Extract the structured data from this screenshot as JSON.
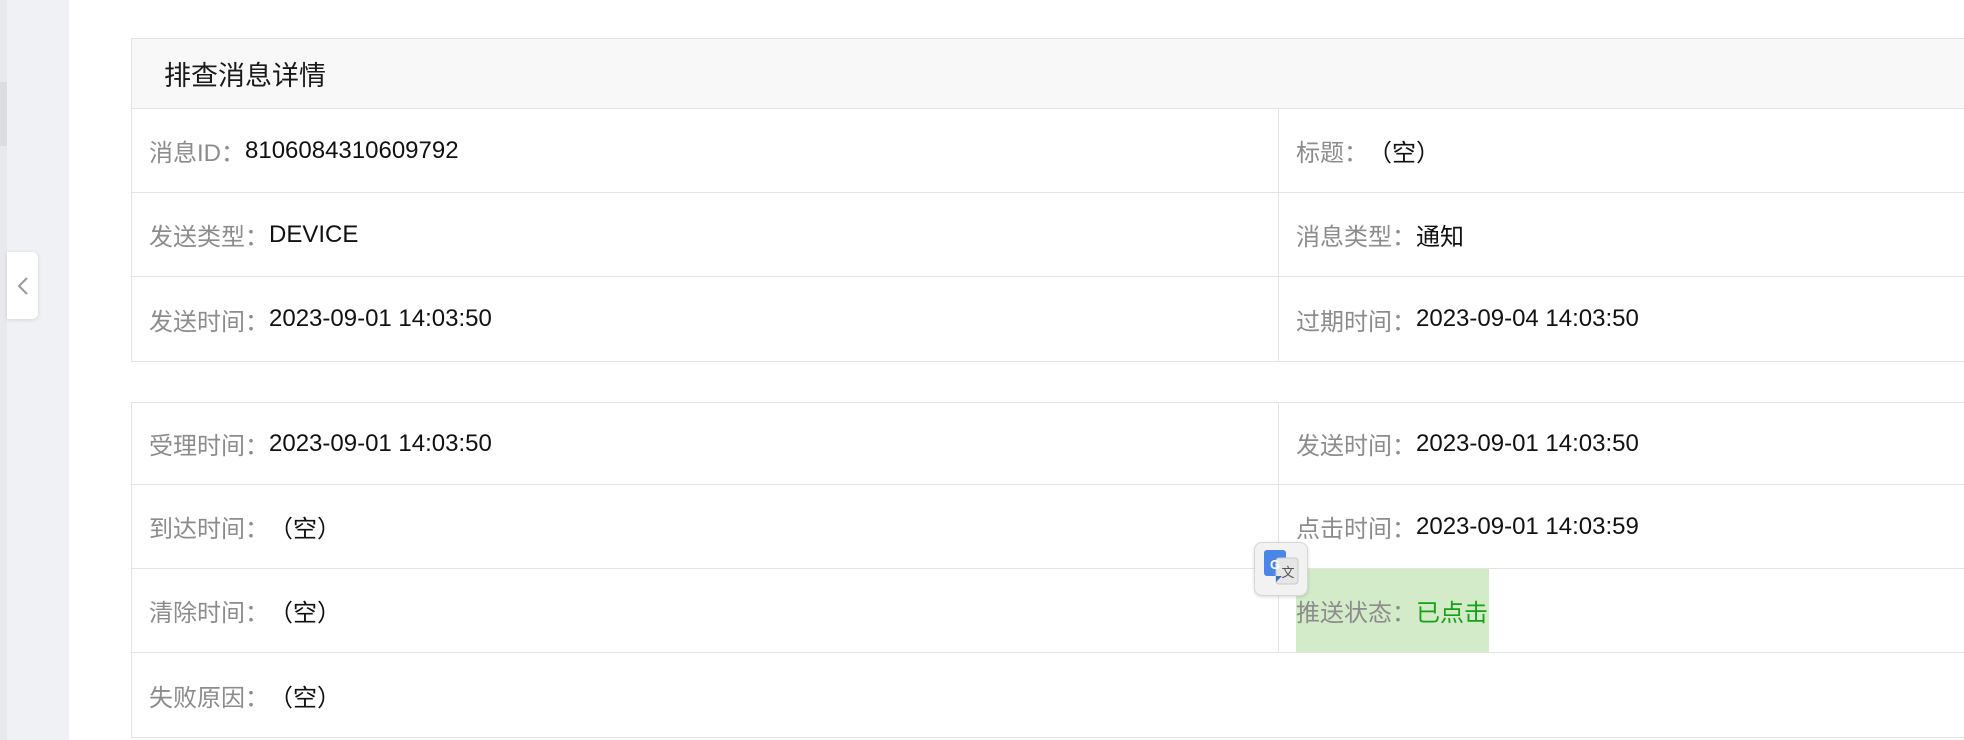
{
  "card1": {
    "title": "排查消息详情",
    "rows": [
      {
        "left_label": "消息ID：",
        "left_value": "8106084310609792",
        "right_label": "标题：",
        "right_value": "（空）"
      },
      {
        "left_label": "发送类型：",
        "left_value": "DEVICE",
        "right_label": "消息类型：",
        "right_value": "通知"
      },
      {
        "left_label": "发送时间：",
        "left_value": "2023-09-01 14:03:50",
        "right_label": "过期时间：",
        "right_value": "2023-09-04 14:03:50"
      }
    ]
  },
  "card2": {
    "rows": [
      {
        "left_label": "受理时间：",
        "left_value": "2023-09-01 14:03:50",
        "right_label": "发送时间：",
        "right_value": "2023-09-01 14:03:50"
      },
      {
        "left_label": "到达时间：",
        "left_value": "（空）",
        "right_label": "点击时间：",
        "right_value": "2023-09-01 14:03:59"
      },
      {
        "left_label": "清除时间：",
        "left_value": "（空）",
        "right_label": "推送状态：",
        "right_value": "已点击"
      }
    ],
    "fail_label": "失败原因：",
    "fail_value": "（空）"
  },
  "icons": {
    "collapse": "chevron-left-icon",
    "translate": "google-translate-icon"
  },
  "colors": {
    "status_clicked": "#16a116",
    "status_highlight": "#d3ebc9",
    "label": "#8c8c8c"
  }
}
